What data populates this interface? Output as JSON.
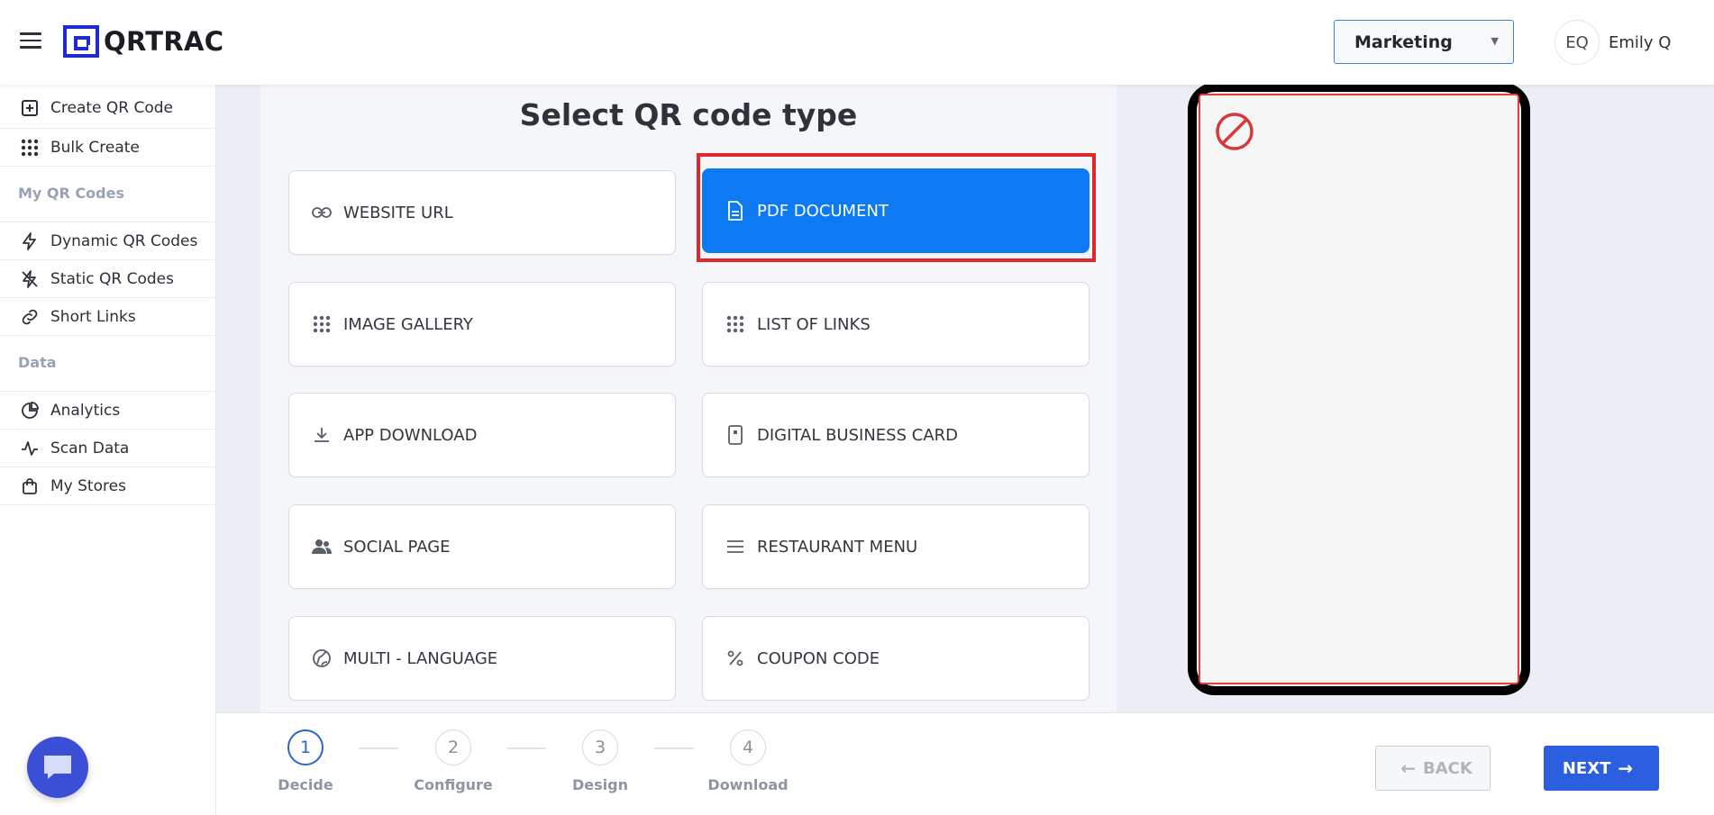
{
  "header": {
    "logo_text": "QRTRAC",
    "workspace": "Marketing",
    "user_initials": "EQ",
    "user_name": "Emily Q"
  },
  "sidebar": {
    "items_top": [
      {
        "label": "Create QR Code",
        "icon": "plus-square-icon"
      },
      {
        "label": "Bulk Create",
        "icon": "grid-dots-icon"
      }
    ],
    "section_my_qr": "My QR Codes",
    "items_qr": [
      {
        "label": "Dynamic QR Codes",
        "icon": "lightning-icon"
      },
      {
        "label": "Static QR Codes",
        "icon": "lightning-off-icon"
      },
      {
        "label": "Short Links",
        "icon": "link-icon"
      }
    ],
    "section_data": "Data",
    "items_data": [
      {
        "label": "Analytics",
        "icon": "pie-chart-icon"
      },
      {
        "label": "Scan Data",
        "icon": "activity-icon"
      },
      {
        "label": "My Stores",
        "icon": "shopping-bag-icon"
      }
    ]
  },
  "main": {
    "title": "Select QR code type",
    "types": [
      {
        "label": "WEBSITE URL",
        "icon": "link-icon"
      },
      {
        "label": "PDF DOCUMENT",
        "icon": "document-icon",
        "selected": true
      },
      {
        "label": "IMAGE GALLERY",
        "icon": "grid-dots-icon"
      },
      {
        "label": "LIST OF LINKS",
        "icon": "grid-dots-icon"
      },
      {
        "label": "APP DOWNLOAD",
        "icon": "download-icon"
      },
      {
        "label": "DIGITAL BUSINESS CARD",
        "icon": "phone-card-icon"
      },
      {
        "label": "SOCIAL PAGE",
        "icon": "people-icon"
      },
      {
        "label": "RESTAURANT MENU",
        "icon": "lines-icon"
      },
      {
        "label": "MULTI - LANGUAGE",
        "icon": "language-icon"
      },
      {
        "label": "COUPON CODE",
        "icon": "percent-icon"
      }
    ]
  },
  "preview": {
    "icon": "no-entry-icon"
  },
  "stepper": {
    "steps": [
      {
        "number": "1",
        "label": "Decide",
        "active": true
      },
      {
        "number": "2",
        "label": "Configure"
      },
      {
        "number": "3",
        "label": "Design"
      },
      {
        "number": "4",
        "label": "Download"
      }
    ],
    "back_label": "BACK",
    "next_label": "NEXT"
  },
  "colors": {
    "accent": "#0d7af4",
    "highlight": "#e0282c",
    "next_button": "#2b5fe0",
    "logo": "#1e2ad4"
  }
}
